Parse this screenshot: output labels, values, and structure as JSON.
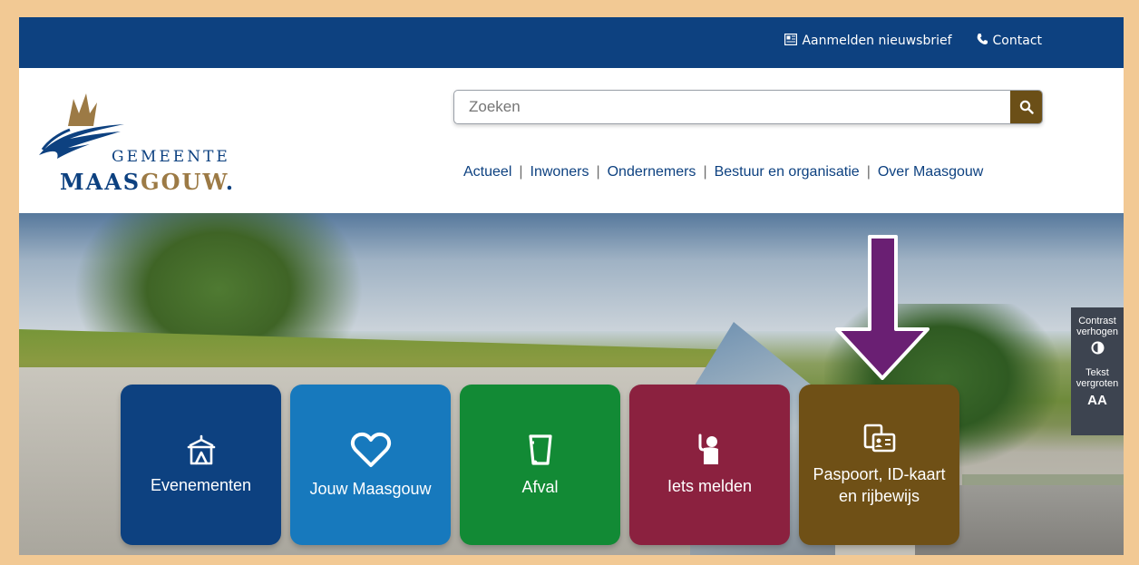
{
  "topbar": {
    "newsletter": "Aanmelden nieuwsbrief",
    "contact": "Contact"
  },
  "logo": {
    "line1": "GEMEENTE",
    "line2a": "MAAS",
    "line2b": "GOUW",
    "line2c": "."
  },
  "search": {
    "placeholder": "Zoeken"
  },
  "nav": [
    {
      "label": "Actueel"
    },
    {
      "label": "Inwoners"
    },
    {
      "label": "Ondernemers"
    },
    {
      "label": "Bestuur en organisatie"
    },
    {
      "label": "Over Maasgouw"
    }
  ],
  "tiles": [
    {
      "label": "Evenementen",
      "icon": "tent-icon",
      "color": "#0d4180"
    },
    {
      "label": "Jouw Maasgouw",
      "icon": "heart-icon",
      "color": "#1779bd"
    },
    {
      "label": "Afval",
      "icon": "trash-bin-icon",
      "color": "#128a35"
    },
    {
      "label": "Iets melden",
      "icon": "person-report-icon",
      "color": "#8b213f"
    },
    {
      "label": "Paspoort, ID-kaart en rijbewijs",
      "icon": "id-card-icon",
      "color": "#6f5016"
    }
  ],
  "accessibility": {
    "contrast": "Contrast verhogen",
    "text": "Tekst vergroten",
    "text_symbol": "AA"
  },
  "colors": {
    "primary": "#0d4180",
    "accent": "#6b4f17",
    "annotation_arrow": "#6a1f73"
  }
}
